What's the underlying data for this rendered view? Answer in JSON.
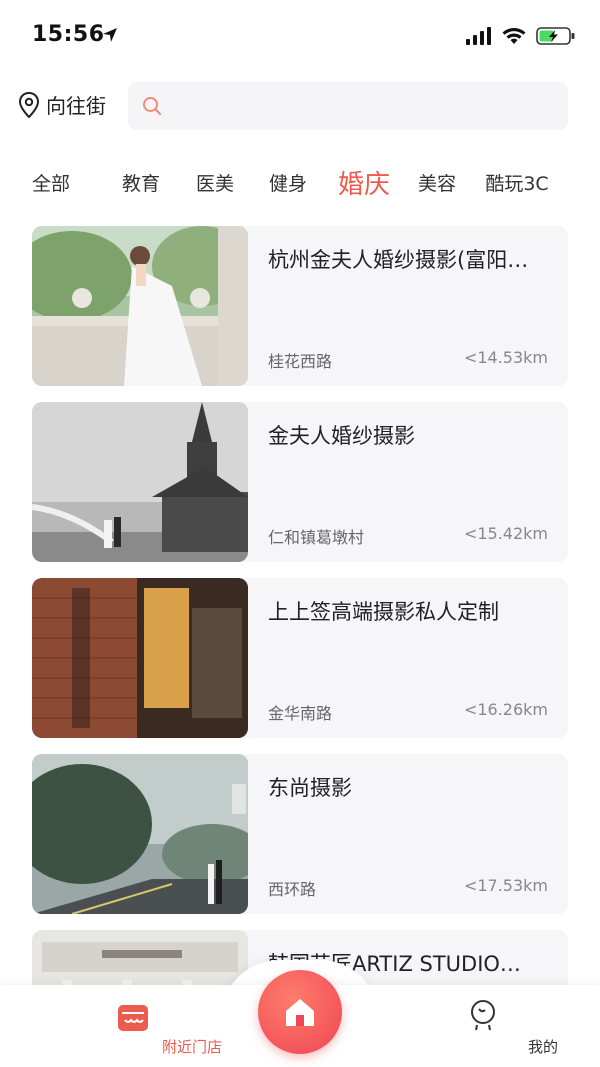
{
  "status_bar": {
    "time": "15:56"
  },
  "header": {
    "location": "向往街",
    "search_placeholder": ""
  },
  "tabs": [
    {
      "label": "全部"
    },
    {
      "label": "教育"
    },
    {
      "label": "医美"
    },
    {
      "label": "健身"
    },
    {
      "label": "婚庆",
      "active": true
    },
    {
      "label": "美容"
    },
    {
      "label": "酷玩3C"
    }
  ],
  "stores": [
    {
      "title": "杭州金夫人婚纱摄影(富阳…",
      "address": "桂花西路",
      "distance": "<14.53km"
    },
    {
      "title": "金夫人婚纱摄影",
      "address": "仁和镇葛墩村",
      "distance": "<15.42km"
    },
    {
      "title": "上上签高端摄影私人定制",
      "address": "金华南路",
      "distance": "<16.26km"
    },
    {
      "title": "东尚摄影",
      "address": "西环路",
      "distance": "<17.53km"
    },
    {
      "title": "韩国艺匠ARTIZ STUDIO…",
      "address": "",
      "distance": ""
    }
  ],
  "bottom_nav": {
    "near_label": "附近门店",
    "mine_label": "我的"
  },
  "colors": {
    "accent": "#ef5a4f",
    "card_bg": "#f6f6f8"
  }
}
